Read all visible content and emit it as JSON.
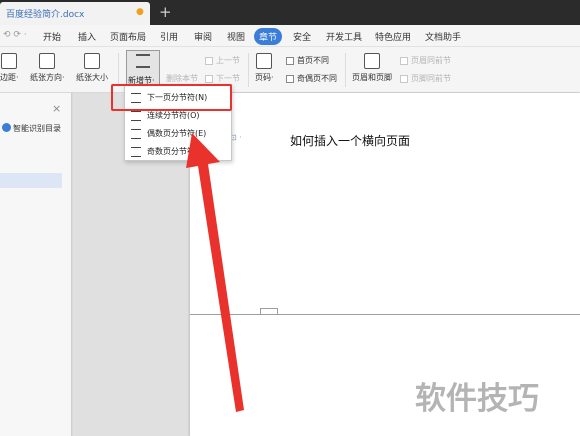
{
  "titlebar": {
    "doc_title": "百度经验简介.docx",
    "modified_mark": "●",
    "new_tab": "+"
  },
  "menubar": {
    "undo": "⟲ ⟳ ·",
    "items": [
      "开始",
      "插入",
      "页面布局",
      "引用",
      "审阅",
      "视图",
      "章节",
      "安全",
      "开发工具",
      "特色应用",
      "文档助手"
    ],
    "active_item": "章节"
  },
  "ribbon": {
    "margin": "边距·",
    "orientation": "纸张方向·",
    "size": "纸张大小",
    "new_section": "新增节·",
    "delete_section": "删除本节",
    "prev_section": "上一节",
    "next_section": "下一节",
    "page_number": "页码·",
    "first_page_diff": "首页不同",
    "odd_even_diff": "奇偶页不同",
    "header_footer": "页眉和页脚",
    "header_same_prev": "页眉同前节",
    "footer_same_prev": "页脚同前节"
  },
  "left_pane": {
    "close": "×",
    "title": "智能识别目录"
  },
  "dropdown": {
    "items": [
      {
        "label": "下一页分节符(N)",
        "icon": "next-page-break-icon"
      },
      {
        "label": "连续分节符(O)",
        "icon": "continuous-break-icon"
      },
      {
        "label": "偶数页分节符(E)",
        "icon": "even-page-break-icon"
      },
      {
        "label": "奇数页分节符(D)",
        "icon": "odd-page-break-icon"
      }
    ]
  },
  "document": {
    "heading": "如何插入一个横向页面",
    "cursor_mark": "⊡ ·"
  },
  "watermark": "软件技巧",
  "colors": {
    "accent": "#3b7ed9",
    "highlight_red": "#e8322b",
    "titlebar": "#2b2b2b"
  }
}
